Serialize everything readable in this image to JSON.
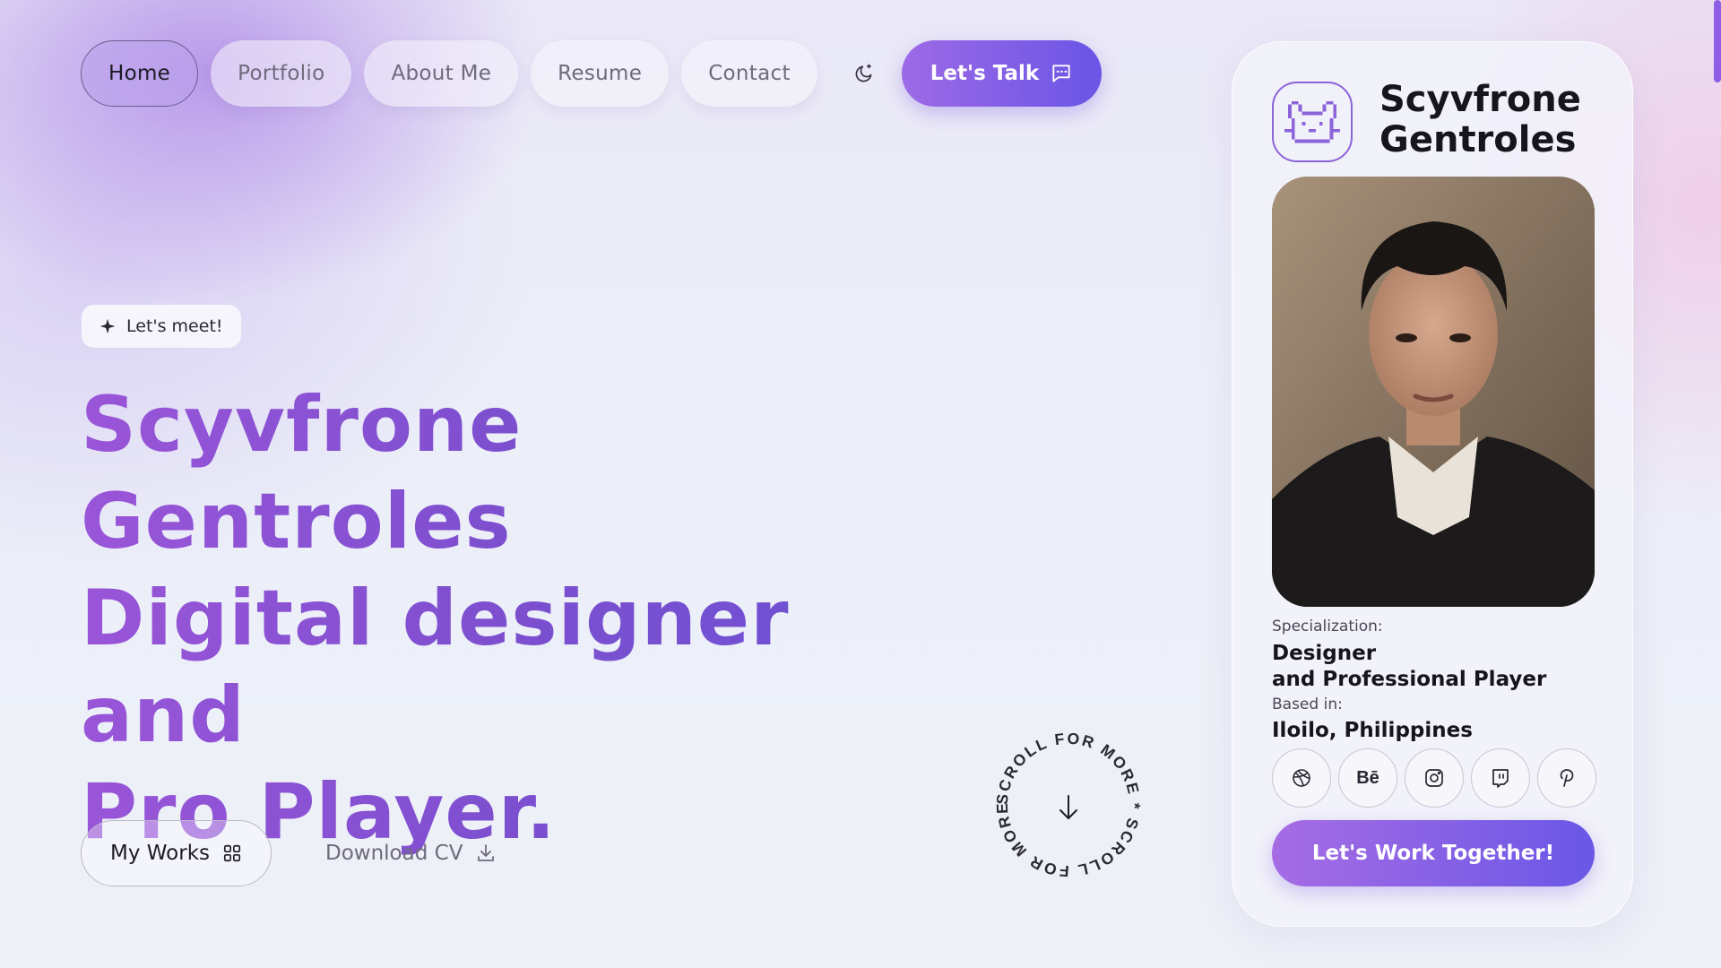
{
  "nav": {
    "items": [
      {
        "label": "Home",
        "active": true
      },
      {
        "label": "Portfolio"
      },
      {
        "label": "About Me"
      },
      {
        "label": "Resume"
      },
      {
        "label": "Contact"
      }
    ],
    "theme_icon": "moon-icon",
    "cta_label": "Let's Talk",
    "cta_icon": "chat-icon"
  },
  "hero": {
    "chip_label": "Let's meet!",
    "chip_icon": "sparkle-icon",
    "title_lines": [
      "Scyvfrone",
      "Gentroles",
      "Digital designer and",
      "Pro Player."
    ],
    "works_label": "My Works",
    "works_icon": "grid-icon",
    "cv_label": "Download CV",
    "cv_icon": "download-icon",
    "scroll_text": "SCROLL FOR MORE * SCROLL FOR MORE * ",
    "scroll_icon": "arrow-down-icon"
  },
  "profile": {
    "logo_icon": "pixel-cat-icon",
    "name": "Scyvfrone Gentroles",
    "specialization_label": "Specialization:",
    "specialization_line1": "Designer",
    "specialization_line2": "and Professional Player",
    "based_label": "Based in:",
    "based_value": "Iloilo, Philippines",
    "socials": [
      "dribbble-icon",
      "behance-icon",
      "instagram-icon",
      "twitch-icon",
      "pinterest-icon"
    ],
    "behance_text": "Bē",
    "cta_label": "Let's Work Together!"
  },
  "colors": {
    "accent": "#7b4fcf",
    "accent_light": "#a66ce4",
    "accent_dark": "#6a57e6",
    "background": "#eceff8"
  }
}
